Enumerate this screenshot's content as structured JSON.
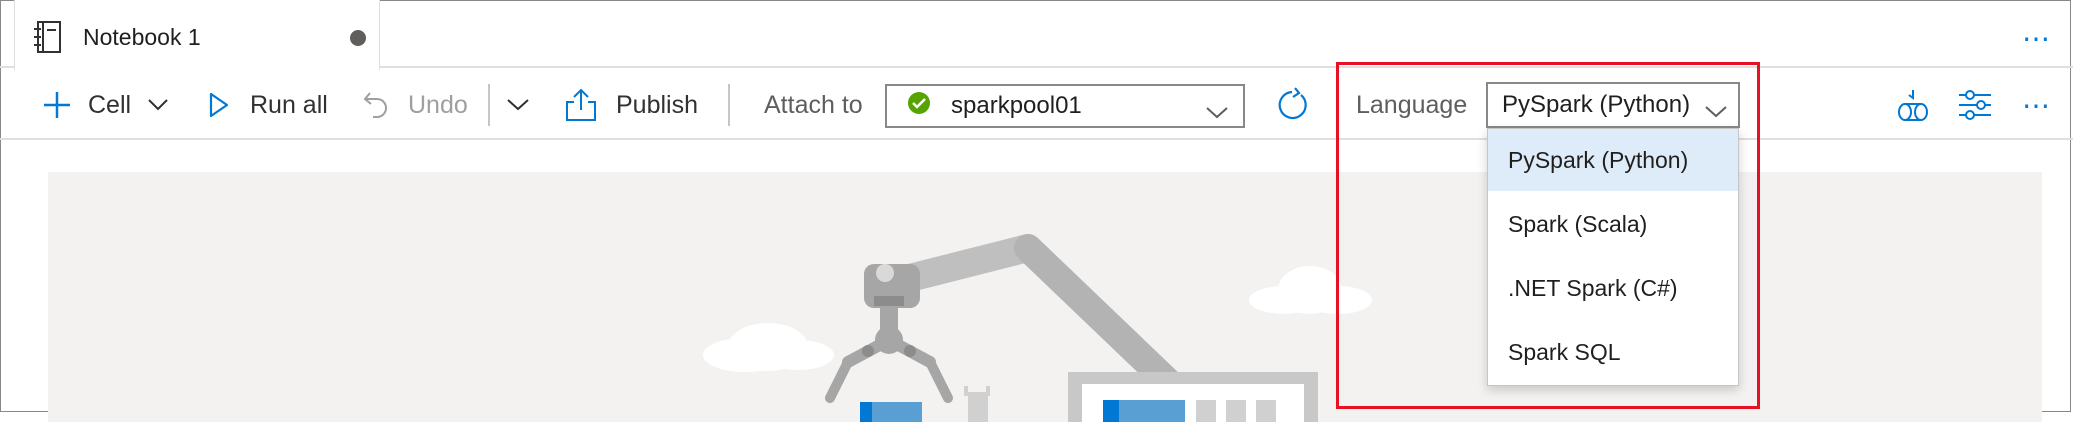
{
  "tab": {
    "title": "Notebook 1",
    "more_label": "⋯"
  },
  "toolbar": {
    "cell_label": "Cell",
    "run_all_label": "Run all",
    "undo_label": "Undo",
    "publish_label": "Publish",
    "attach_to_label": "Attach to",
    "attach_value": "sparkpool01",
    "language_label": "Language",
    "language_value": "PySpark (Python)",
    "more_label": "⋯"
  },
  "language_dropdown": {
    "options": [
      {
        "label": "PySpark (Python)",
        "selected": true
      },
      {
        "label": "Spark (Scala)",
        "selected": false
      },
      {
        "label": ".NET Spark (C#)",
        "selected": false
      },
      {
        "label": "Spark SQL",
        "selected": false
      }
    ]
  },
  "colors": {
    "accent": "#0078d4",
    "status_ok": "#57a300",
    "highlight": "#e81123",
    "selected_option": "#deecf9"
  }
}
